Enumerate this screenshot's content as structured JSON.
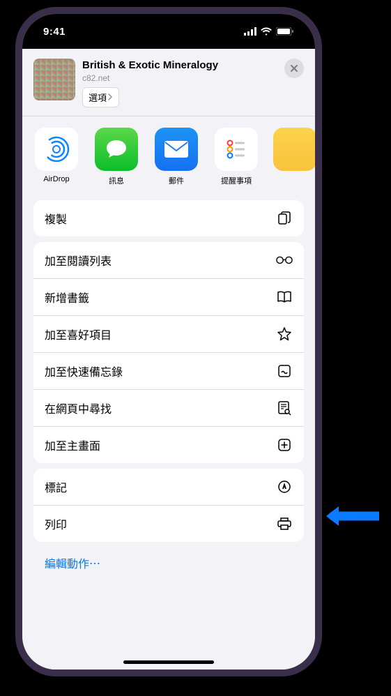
{
  "statusbar": {
    "time": "9:41"
  },
  "header": {
    "title": "British & Exotic Mineralogy",
    "subtitle": "c82.net",
    "options_label": "選項"
  },
  "apps": [
    {
      "label": "AirDrop",
      "name": "airdrop"
    },
    {
      "label": "訊息",
      "name": "messages"
    },
    {
      "label": "郵件",
      "name": "mail"
    },
    {
      "label": "提醒事項",
      "name": "reminders"
    }
  ],
  "group_copy": {
    "copy": "複製"
  },
  "group_main": {
    "reading_list": "加至閱讀列表",
    "add_bookmark": "新增書籤",
    "add_favorite": "加至喜好項目",
    "quick_note": "加至快速備忘錄",
    "find_on_page": "在網頁中尋找",
    "add_to_home": "加至主畫面"
  },
  "group_markup": {
    "markup": "標記",
    "print": "列印"
  },
  "edit_actions": "編輯動作⋯"
}
